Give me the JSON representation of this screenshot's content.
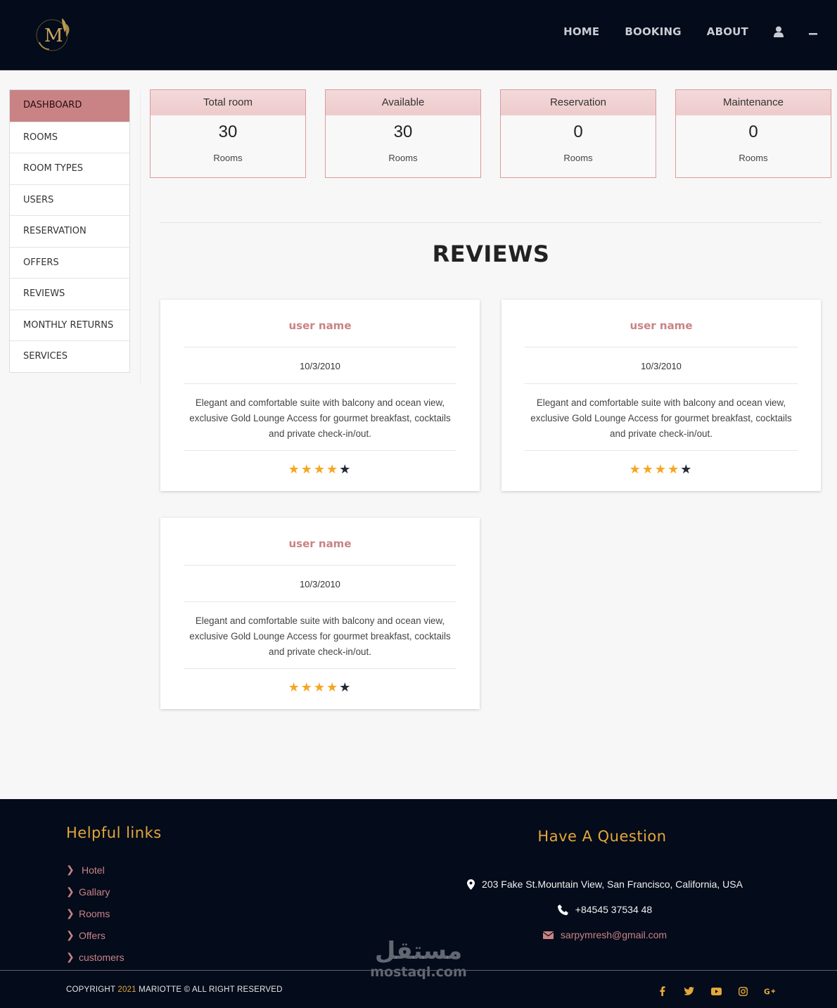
{
  "header": {
    "nav": [
      "HOME",
      "BOOKING",
      "ABOUT"
    ],
    "logo_letter": "M"
  },
  "sidebar": {
    "items": [
      {
        "label": "DASHBOARD"
      },
      {
        "label": "ROOMS"
      },
      {
        "label": "ROOM TYPES"
      },
      {
        "label": "USERS"
      },
      {
        "label": "RESERVATION"
      },
      {
        "label": "OFFERS"
      },
      {
        "label": "REVIEWS"
      },
      {
        "label": "MONTHLY RETURNS"
      },
      {
        "label": "SERVICES"
      }
    ],
    "active": "DASHBOARD"
  },
  "stats": [
    {
      "title": "Total room",
      "value": "30",
      "unit": "Rooms"
    },
    {
      "title": "Available",
      "value": "30",
      "unit": "Rooms"
    },
    {
      "title": "Reservation",
      "value": "0",
      "unit": "Rooms"
    },
    {
      "title": "Maintenance",
      "value": "0",
      "unit": "Rooms"
    }
  ],
  "reviews": {
    "title": "REVIEWS",
    "items": [
      {
        "user": "user name",
        "date": "10/3/2010",
        "text": "Elegant and comfortable suite with balcony and ocean view, exclusive Gold Lounge Access for gourmet breakfast, cocktails and private check-in/out.",
        "rating": 4,
        "max": 5
      },
      {
        "user": "user name",
        "date": "10/3/2010",
        "text": "Elegant and comfortable suite with balcony and ocean view, exclusive Gold Lounge Access for gourmet breakfast, cocktails and private check-in/out.",
        "rating": 4,
        "max": 5
      },
      {
        "user": "user name",
        "date": "10/3/2010",
        "text": "Elegant and comfortable suite with balcony and ocean view, exclusive Gold Lounge Access for gourmet breakfast, cocktails and private check-in/out.",
        "rating": 4,
        "max": 5
      }
    ]
  },
  "footer": {
    "links_title": "Helpful links",
    "links": [
      "Hotel",
      "Gallary",
      "Rooms",
      "Offers",
      "customers"
    ],
    "question_title": "Have A Question",
    "address": "203 Fake St.Mountain View, San Francisco, California, USA",
    "phone": "+84545 37534 48",
    "email": "sarpymresh@gmail.com",
    "copyright_pre": "COPYRIGHT",
    "copyright_year": "2021",
    "copyright_post": "MARIOTTE © ALL RIGHT RESERVED",
    "socials": [
      "facebook-icon",
      "twitter-icon",
      "youtube-icon",
      "instagram-icon",
      "google-plus-icon"
    ],
    "watermark_ar": "مستقل",
    "watermark_en": "mostaql.com"
  },
  "colors": {
    "accent": "#c98385",
    "gold": "#e3a73a",
    "dark": "#040b1a",
    "star": "#f5a623"
  }
}
